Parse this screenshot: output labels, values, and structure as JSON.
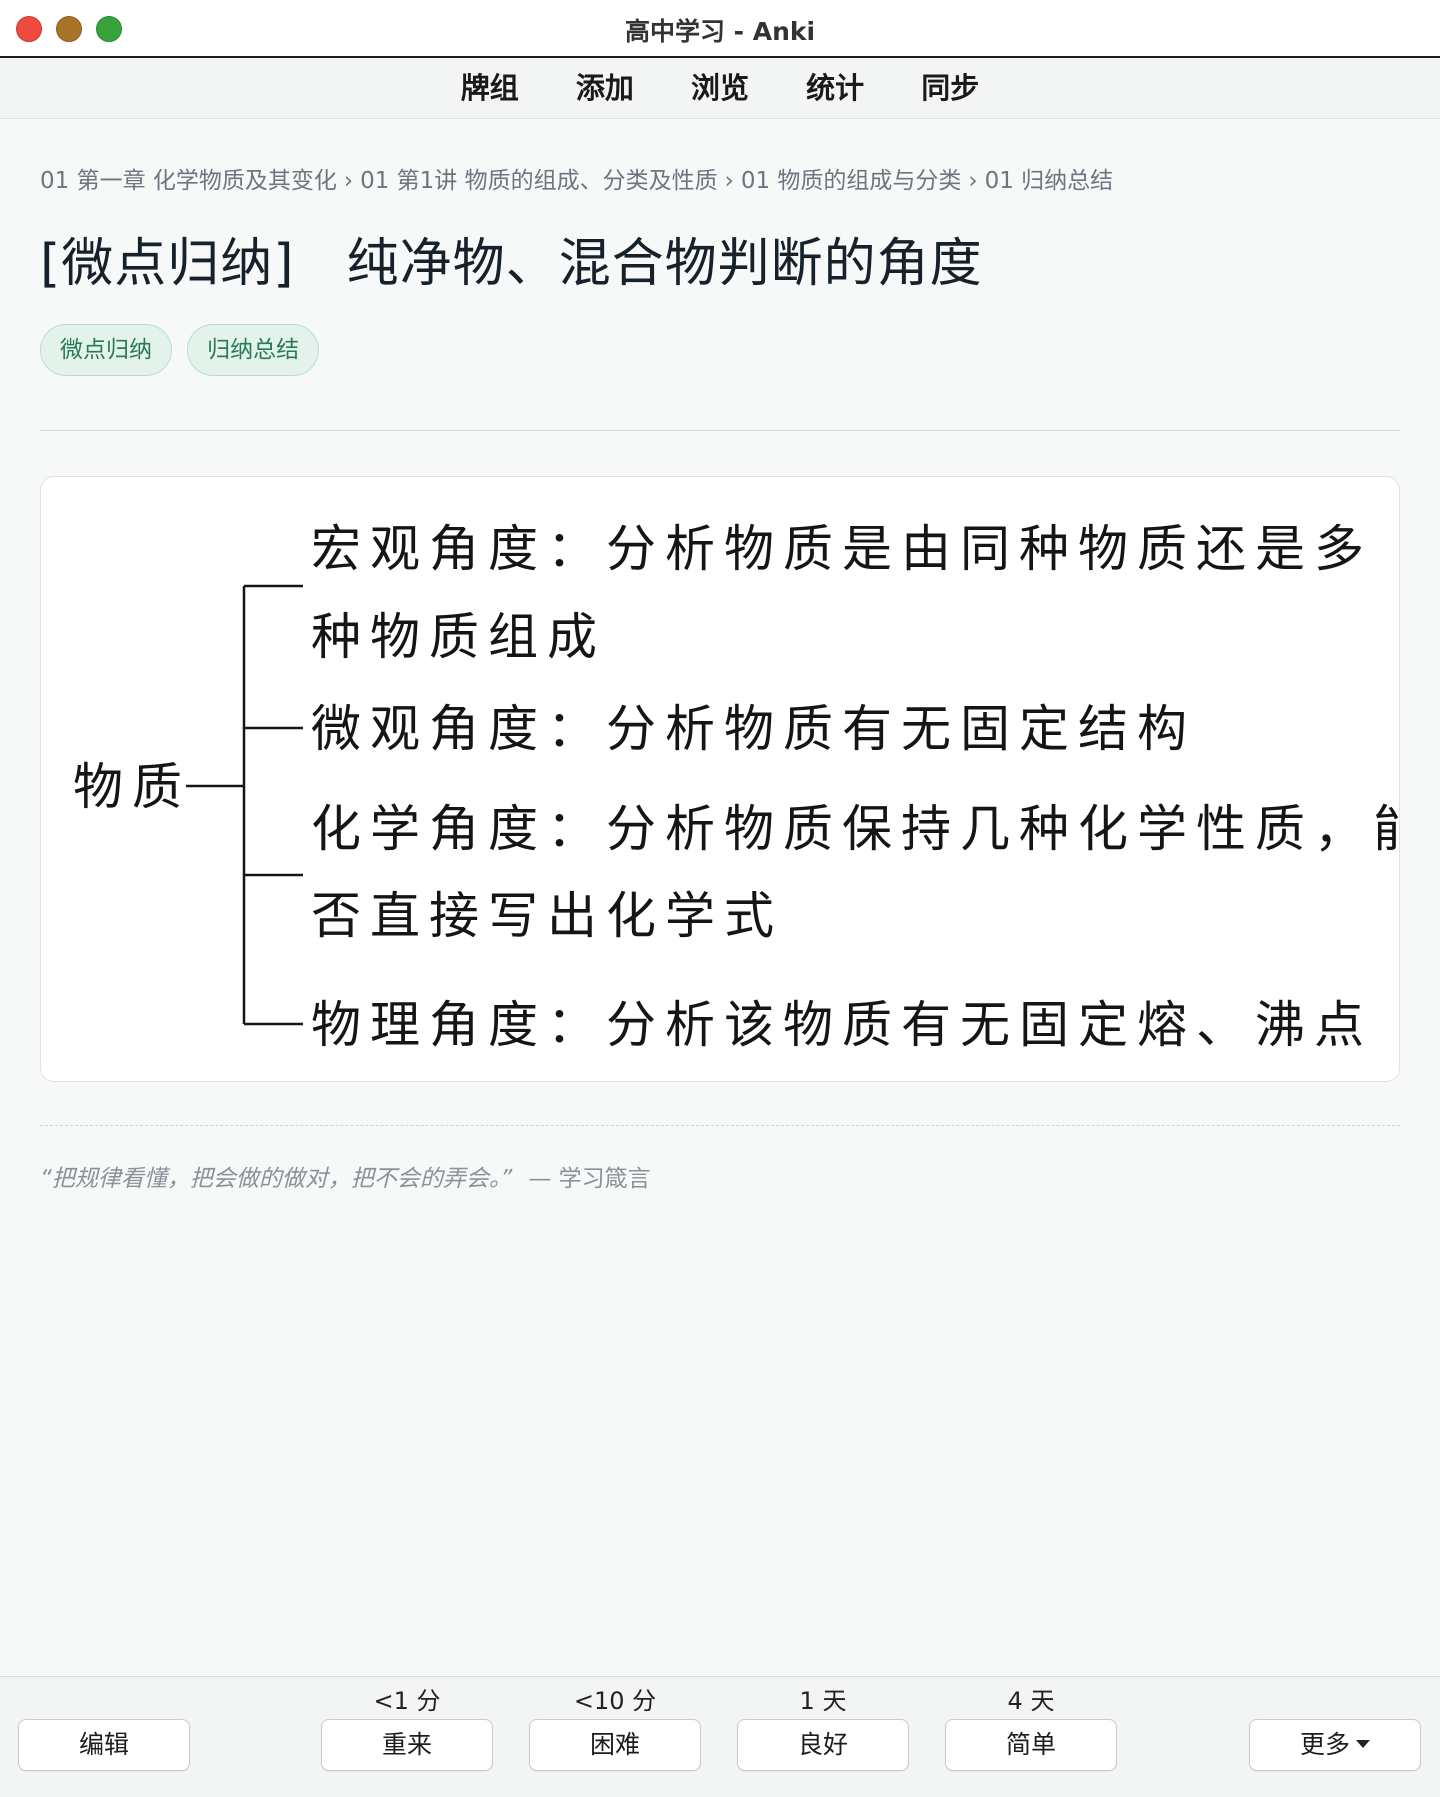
{
  "window": {
    "title": "高中学习 - Anki"
  },
  "nav": {
    "items": [
      {
        "label": "牌组"
      },
      {
        "label": "添加"
      },
      {
        "label": "浏览"
      },
      {
        "label": "统计"
      },
      {
        "label": "同步"
      }
    ]
  },
  "breadcrumb": {
    "items": [
      "01 第一章 化学物质及其变化",
      "01 第1讲 物质的组成、分类及性质",
      "01 物质的组成与分类",
      "01 归纳总结"
    ],
    "separator": "›"
  },
  "card": {
    "title_prefix": "[微点归纳]",
    "title": "纯净物、混合物判断的角度",
    "tags": [
      "微点归纳",
      "归纳总结"
    ],
    "figure": {
      "root": "物质",
      "branches": [
        {
          "lines": [
            "宏观角度：分析物质是由同种物质还是多",
            "种物质组成"
          ]
        },
        {
          "lines": [
            "微观角度：分析物质有无固定结构"
          ]
        },
        {
          "lines": [
            "化学角度：分析物质保持几种化学性质，能",
            "否直接写出化学式"
          ]
        },
        {
          "lines": [
            "物理角度：分析该物质有无固定熔、沸点"
          ]
        }
      ]
    },
    "quote": {
      "text": "“把规律看懂，把会做的做对，把不会的弄会。”",
      "source": "— 学习箴言"
    }
  },
  "answer_bar": {
    "edit_label": "编辑",
    "more_label": "更多",
    "buttons": [
      {
        "label": "重来",
        "interval": "<1 分"
      },
      {
        "label": "困难",
        "interval": "<10 分"
      },
      {
        "label": "良好",
        "interval": "1 天"
      },
      {
        "label": "简单",
        "interval": "4 天"
      }
    ]
  },
  "colors": {
    "tag_bg": "#e3f3ec",
    "tag_text": "#2a7a58",
    "close": "#ed4b3f",
    "minimize": "#a8742a",
    "maximize": "#36a33c"
  }
}
